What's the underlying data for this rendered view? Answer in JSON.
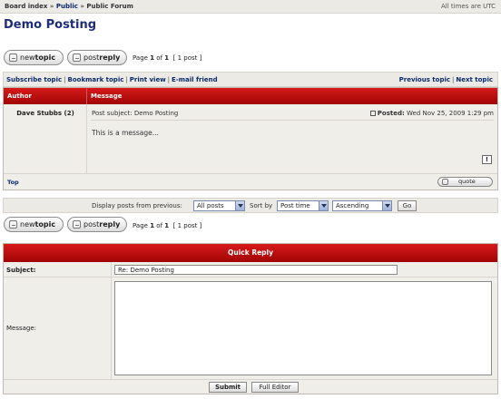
{
  "breadcrumb": {
    "items": [
      "Board index",
      "Public",
      "Public Forum"
    ],
    "sep": "»"
  },
  "timezone": "All times are UTC",
  "topic_title": "Demo Posting",
  "actions": {
    "newtopic_a": "new",
    "newtopic_b": "topic",
    "postreply_a": "post",
    "postreply_b": "reply"
  },
  "pagination": {
    "label": "Page",
    "current": "1",
    "of_word": "of",
    "total": "1",
    "count": "[ 1 post ]"
  },
  "options": {
    "subscribe": "Subscribe topic",
    "bookmark": "Bookmark topic",
    "print": "Print view",
    "email": "E-mail friend",
    "prev": "Previous topic",
    "next": "Next topic",
    "sep": "|"
  },
  "post": {
    "header_author": "Author",
    "header_message": "Message",
    "author": "Dave Stubbs (2)",
    "subject_label": "Post subject:",
    "subject": "Demo Posting",
    "posted_label": "Posted:",
    "posted_date": "Wed Nov 25, 2009 1:29 pm",
    "body": "This is a message...",
    "report_glyph": "!",
    "top_link": "Top",
    "quote_label": "quote"
  },
  "sortbar": {
    "display_label": "Display posts from previous:",
    "display_value": "All posts",
    "sort_label": "Sort by",
    "sort_value": "Post time",
    "order_value": "Ascending",
    "go_label": "Go"
  },
  "quick_reply": {
    "title": "Quick Reply",
    "subject_label": "Subject:",
    "subject_value": "Re: Demo Posting",
    "message_label": "Message:",
    "submit_label": "Submit",
    "fulleditor_label": "Full Editor"
  },
  "colors": {
    "accent_red": "#c40c0c",
    "link_blue": "#0a2a6e",
    "title_blue": "#1d2d7a",
    "panel": "#ebeae4"
  }
}
